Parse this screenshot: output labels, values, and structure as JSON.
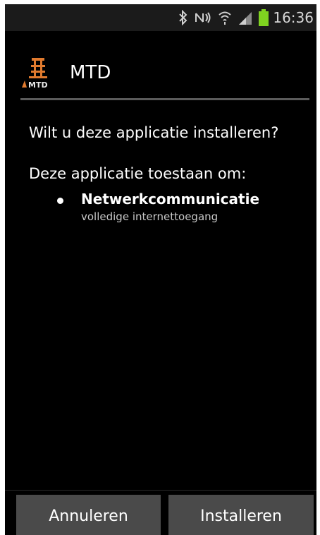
{
  "status_bar": {
    "time": "16:36",
    "icons": [
      "bluetooth-icon",
      "nfc-icon",
      "wifi-icon",
      "signal-icon",
      "battery-icon"
    ],
    "battery_color": "#7fd320"
  },
  "dialog": {
    "app_title": "MTD",
    "app_icon_text": "MTD",
    "question": "Wilt u deze applicatie installeren?",
    "permissions_heading": "Deze applicatie toestaan om:",
    "permissions": [
      {
        "title": "Netwerkcommunicatie",
        "description": "volledige internettoegang"
      }
    ]
  },
  "buttons": {
    "cancel_label": "Annuleren",
    "install_label": "Installeren"
  },
  "colors": {
    "background": "#000000",
    "button": "#4a4a4a",
    "divider": "#5b5b5b",
    "logo_orange": "#e07a2e"
  }
}
